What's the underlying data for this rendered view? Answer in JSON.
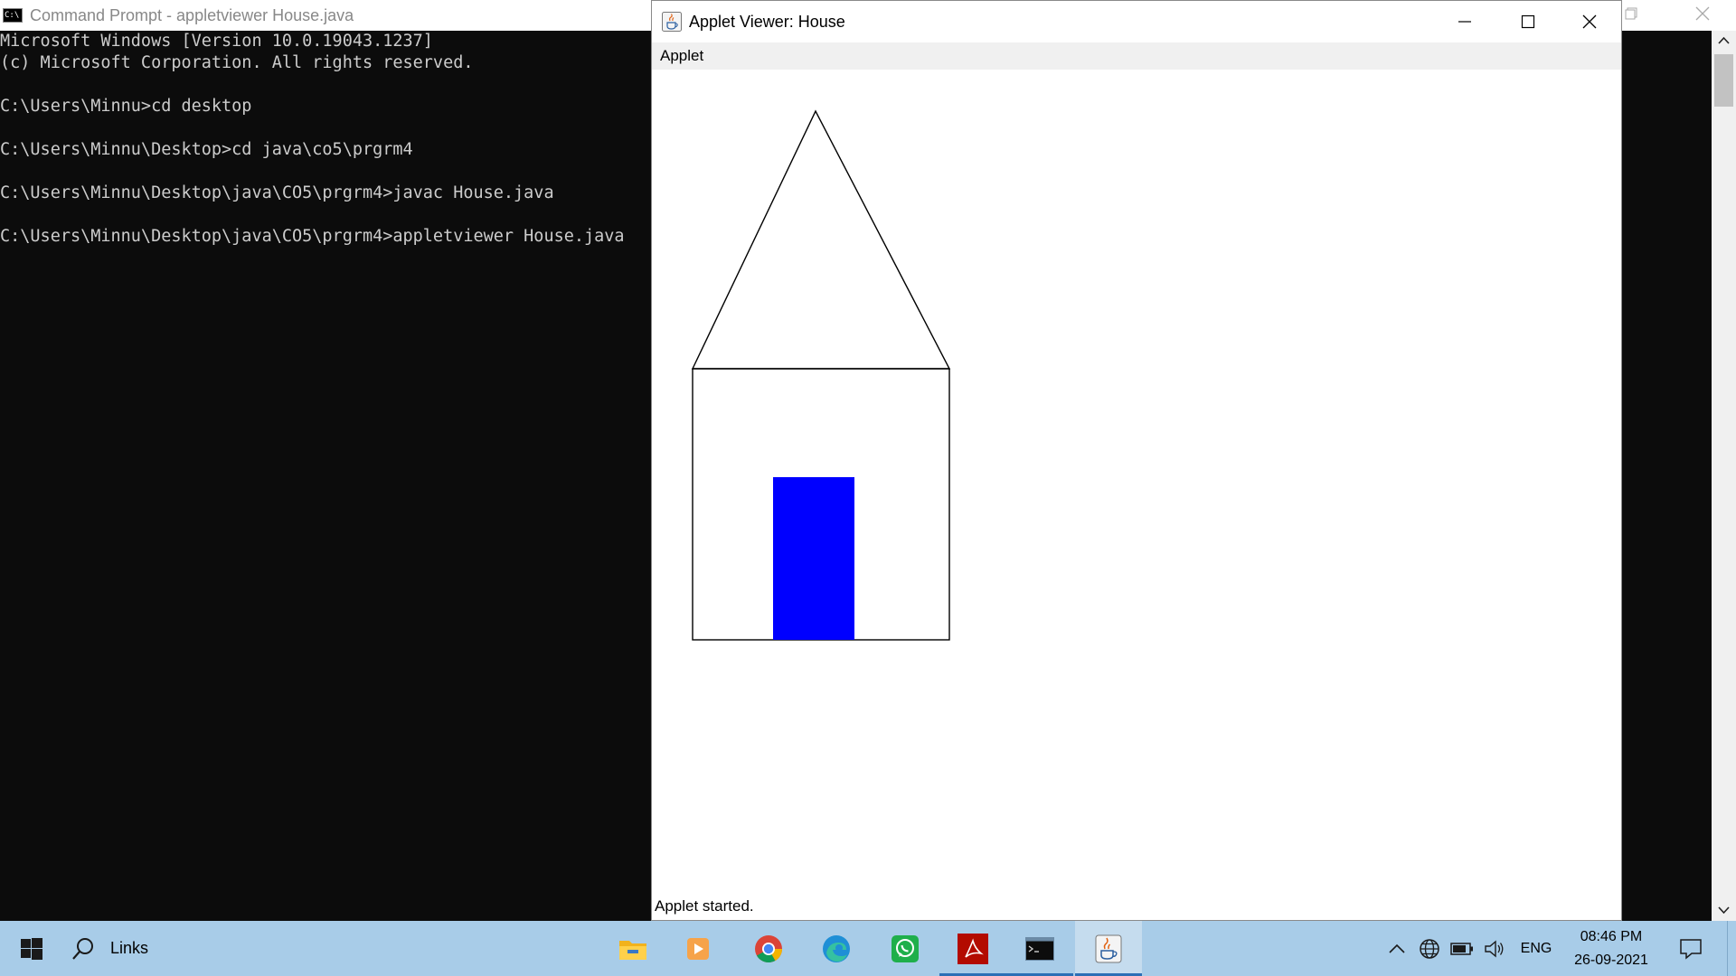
{
  "cmd": {
    "title": "Command Prompt - appletviewer  House.java",
    "icon": "C:\\",
    "lines": [
      "Microsoft Windows [Version 10.0.19043.1237]",
      "(c) Microsoft Corporation. All rights reserved.",
      "",
      "C:\\Users\\Minnu>cd desktop",
      "",
      "C:\\Users\\Minnu\\Desktop>cd java\\co5\\prgrm4",
      "",
      "C:\\Users\\Minnu\\Desktop\\java\\CO5\\prgrm4>javac House.java",
      "",
      "C:\\Users\\Minnu\\Desktop\\java\\CO5\\prgrm4>appletviewer House.java"
    ]
  },
  "applet": {
    "title": "Applet Viewer: House",
    "menu": [
      "Applet"
    ],
    "status": "Applet started.",
    "door_color": "#0000ff"
  },
  "taskbar": {
    "search_label": "Links",
    "apps": [
      "file-explorer",
      "media-player",
      "chrome",
      "edge",
      "whatsapp",
      "acrobat-reader",
      "command-prompt",
      "java"
    ],
    "lang": "ENG",
    "time": "08:46 PM",
    "date": "26-09-2021"
  }
}
